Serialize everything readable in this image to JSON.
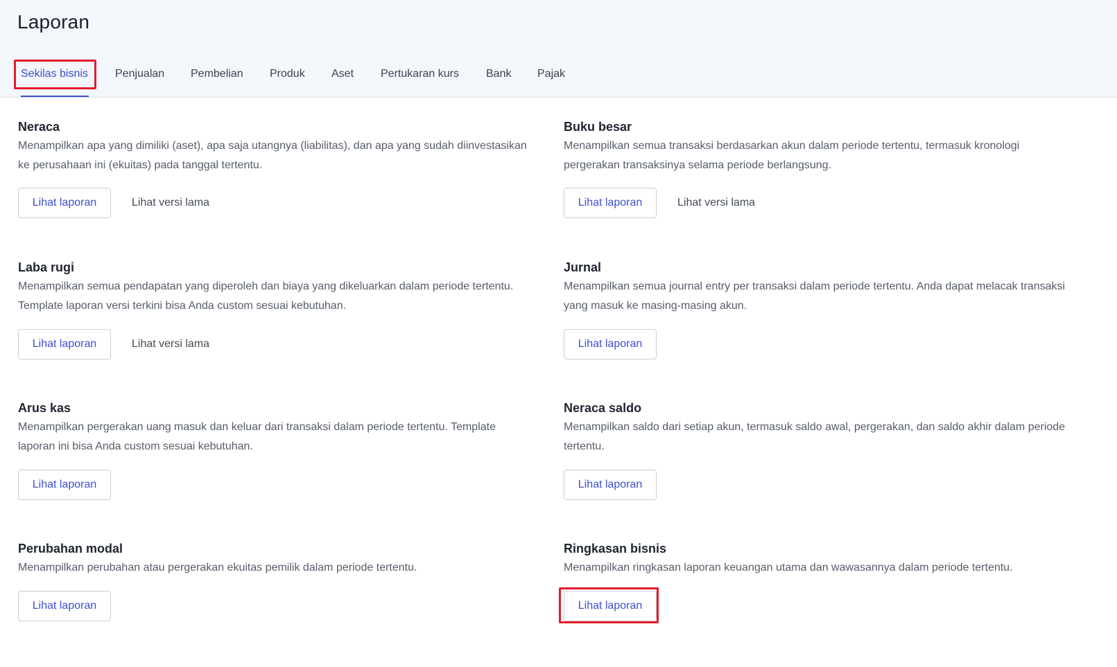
{
  "page": {
    "title": "Laporan"
  },
  "tabs": [
    {
      "label": "Sekilas bisnis",
      "active": true
    },
    {
      "label": "Penjualan"
    },
    {
      "label": "Pembelian"
    },
    {
      "label": "Produk"
    },
    {
      "label": "Aset"
    },
    {
      "label": "Pertukaran kurs"
    },
    {
      "label": "Bank"
    },
    {
      "label": "Pajak"
    }
  ],
  "reports": [
    {
      "title": "Neraca",
      "description": "Menampilkan apa yang dimiliki (aset), apa saja utangnya (liabilitas), dan apa yang sudah diinvestasikan ke perusahaan ini (ekuitas) pada tanggal tertentu.",
      "primary_label": "Lihat laporan",
      "secondary_label": "Lihat versi lama"
    },
    {
      "title": "Buku besar",
      "description": "Menampilkan semua transaksi berdasarkan akun dalam periode tertentu, termasuk kronologi pergerakan transaksinya selama periode berlangsung.",
      "primary_label": "Lihat laporan",
      "secondary_label": "Lihat versi lama"
    },
    {
      "title": "Laba rugi",
      "description": "Menampilkan semua pendapatan yang diperoleh dan biaya yang dikeluarkan dalam periode tertentu. Template laporan versi terkini bisa Anda custom sesuai kebutuhan.",
      "primary_label": "Lihat laporan",
      "secondary_label": "Lihat versi lama"
    },
    {
      "title": "Jurnal",
      "description": "Menampilkan semua journal entry per transaksi dalam periode tertentu. Anda dapat melacak transaksi yang masuk ke masing-masing akun.",
      "primary_label": "Lihat laporan"
    },
    {
      "title": "Arus kas",
      "description": "Menampilkan pergerakan uang masuk dan keluar dari transaksi dalam periode tertentu. Template laporan ini bisa Anda custom sesuai kebutuhan.",
      "primary_label": "Lihat laporan"
    },
    {
      "title": "Neraca saldo",
      "description": "Menampilkan saldo dari setiap akun, termasuk saldo awal, pergerakan, dan saldo akhir dalam periode tertentu.",
      "primary_label": "Lihat laporan"
    },
    {
      "title": "Perubahan modal",
      "description": "Menampilkan perubahan atau pergerakan ekuitas pemilik dalam periode tertentu.",
      "primary_label": "Lihat laporan"
    },
    {
      "title": "Ringkasan bisnis",
      "description": "Menampilkan ringkasan laporan keuangan utama dan wawasannya dalam periode tertentu.",
      "primary_label": "Lihat laporan"
    }
  ],
  "colors": {
    "accent": "#3b4fd1",
    "highlight": "#e21b2b",
    "header_bg": "#f3f6fa"
  }
}
